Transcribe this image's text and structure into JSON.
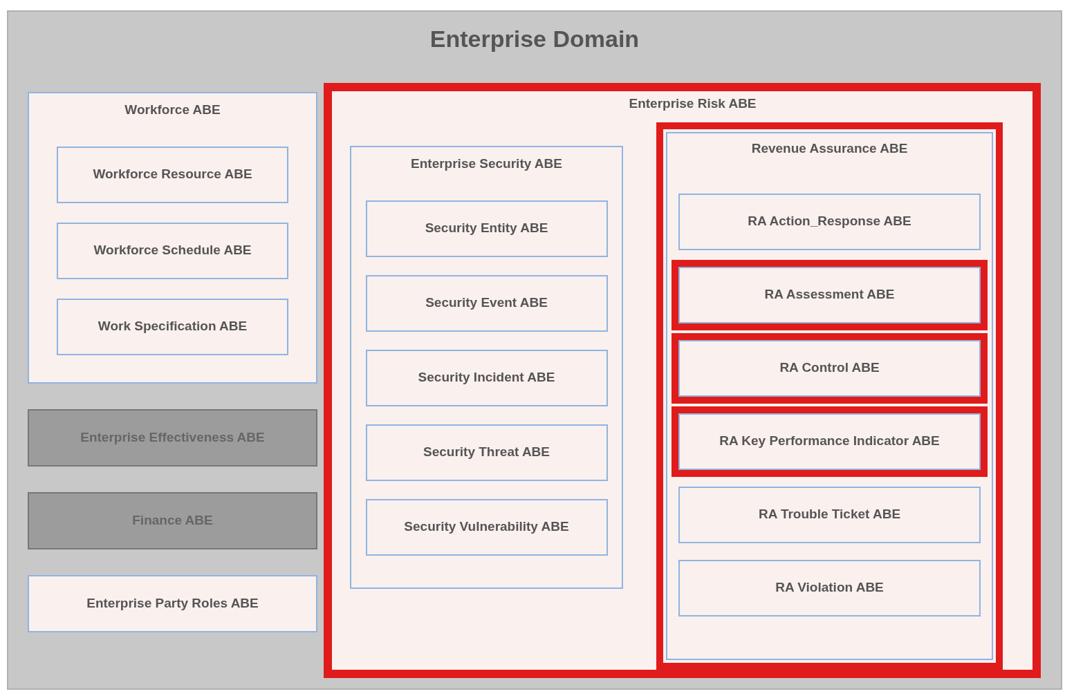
{
  "title": "Enterprise Domain",
  "workforce": {
    "name": "Workforce ABE",
    "children": [
      {
        "name": "Workforce Resource ABE"
      },
      {
        "name": "Workforce Schedule ABE"
      },
      {
        "name": "Work Specification ABE"
      }
    ]
  },
  "other_abes": [
    {
      "name": "Enterprise Effectiveness ABE",
      "disabled": true
    },
    {
      "name": "Finance ABE",
      "disabled": true
    },
    {
      "name": "Enterprise Party Roles ABE",
      "disabled": false
    }
  ],
  "enterprise_risk": {
    "name": "Enterprise Risk ABE",
    "highlighted": true,
    "security": {
      "name": "Enterprise Security ABE",
      "children": [
        {
          "name": "Security Entity ABE"
        },
        {
          "name": "Security Event ABE"
        },
        {
          "name": "Security Incident ABE"
        },
        {
          "name": "Security Threat ABE"
        },
        {
          "name": "Security Vulnerability ABE"
        }
      ]
    },
    "revenue_assurance": {
      "name": "Revenue Assurance ABE",
      "highlighted": true,
      "children": [
        {
          "name": "RA Action_Response ABE",
          "highlighted": false
        },
        {
          "name": "RA Assessment ABE",
          "highlighted": true
        },
        {
          "name": "RA Control ABE",
          "highlighted": true
        },
        {
          "name": "RA Key Performance Indicator ABE",
          "highlighted": true
        },
        {
          "name": "RA Trouble Ticket ABE",
          "highlighted": false
        },
        {
          "name": "RA Violation ABE",
          "highlighted": false
        }
      ]
    }
  }
}
